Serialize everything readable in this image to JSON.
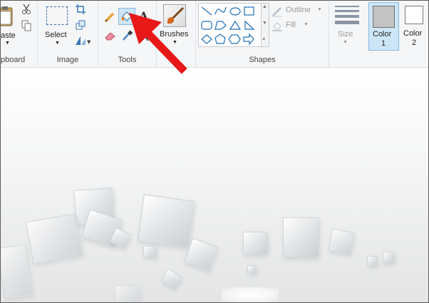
{
  "ribbon": {
    "clipboard": {
      "paste_label": "aste",
      "group_label": "pboard"
    },
    "image": {
      "select_label": "Select",
      "group_label": "Image"
    },
    "tools": {
      "group_label": "Tools"
    },
    "brushes": {
      "label": "Brushes"
    },
    "shapes": {
      "group_label": "Shapes",
      "outline_label": "Outline",
      "fill_label": "Fill"
    },
    "size": {
      "label": "Size"
    },
    "colors": {
      "color1_label": "Color\n1",
      "color1_line1": "Color",
      "color1_line2": "1",
      "color2_line1": "Color",
      "color2_line2": "2",
      "color1_value": "#c3c3c3",
      "color2_value": "#ffffff"
    }
  },
  "canvas": {
    "image_text": "",
    "description_colors": {
      "background": "#eceded",
      "accent": "#e81818"
    }
  },
  "annotation": {
    "arrow_color": "#e81818"
  }
}
